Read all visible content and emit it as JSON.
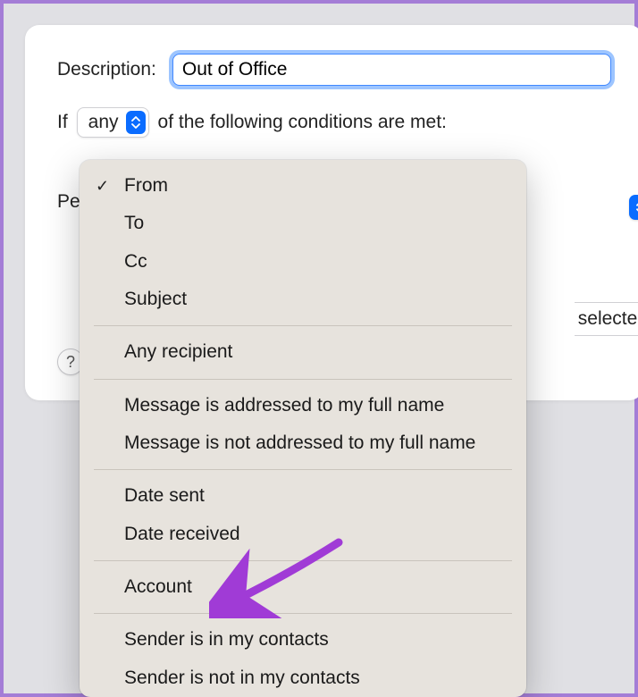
{
  "description": {
    "label": "Description:",
    "value": "Out of Office"
  },
  "condition_row": {
    "prefix": "If",
    "selector_value": "any",
    "suffix": "of the following conditions are met:"
  },
  "perform_prefix": "Pe",
  "partial_visible": " selected",
  "help_label": "?",
  "menu": {
    "groups": [
      [
        {
          "label": "From",
          "checked": true
        },
        {
          "label": "To",
          "checked": false
        },
        {
          "label": "Cc",
          "checked": false
        },
        {
          "label": "Subject",
          "checked": false
        }
      ],
      [
        {
          "label": "Any recipient",
          "checked": false
        }
      ],
      [
        {
          "label": "Message is addressed to my full name",
          "checked": false
        },
        {
          "label": "Message is not addressed to my full name",
          "checked": false
        }
      ],
      [
        {
          "label": "Date sent",
          "checked": false
        },
        {
          "label": "Date received",
          "checked": false
        }
      ],
      [
        {
          "label": "Account",
          "checked": false
        }
      ],
      [
        {
          "label": "Sender is in my contacts",
          "checked": false
        },
        {
          "label": "Sender is not in my contacts",
          "checked": false
        }
      ]
    ]
  }
}
